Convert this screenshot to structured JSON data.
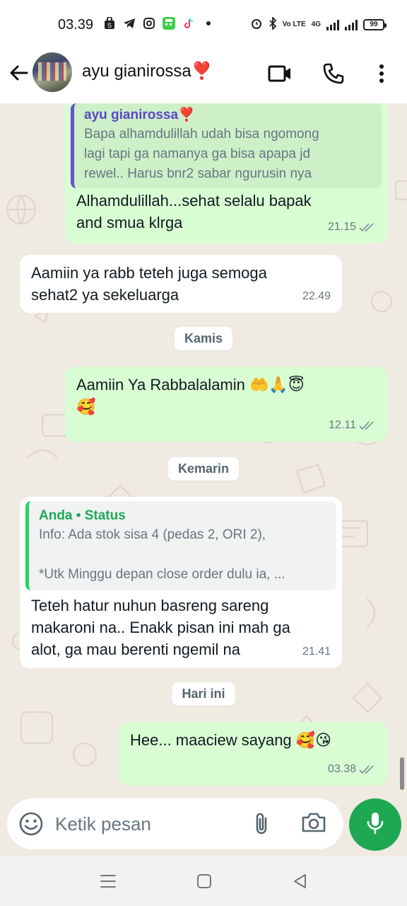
{
  "status_bar": {
    "time": "03.39",
    "battery": "99",
    "network": "4G",
    "volte": "Vo LTE",
    "icons_left": [
      "shopee-icon",
      "telegram-icon",
      "instagram-icon",
      "calculator-icon",
      "tiktok-icon",
      "dot-icon"
    ],
    "icons_right": [
      "alarm-icon",
      "bluetooth-icon",
      "volte-icon",
      "signal-icon",
      "signal-icon",
      "battery-icon"
    ]
  },
  "header": {
    "contact_name": "ayu gianirossa❣️",
    "icons": [
      "back-arrow-icon",
      "video-call-icon",
      "phone-icon",
      "more-vert-icon"
    ]
  },
  "messages": [
    {
      "direction": "out",
      "quote": {
        "name": "ayu gianirossa❣️",
        "lines": [
          "Bapa alhamdulillah udah bisa ngomong",
          "lagi tapi ga namanya ga bisa apapa jd",
          "rewel.. Harus bnr2 sabar ngurusin nya"
        ]
      },
      "lines": [
        "Alhamdulillah...sehat selalu bapak",
        "and smua klrga"
      ],
      "time": "21.15"
    },
    {
      "direction": "in",
      "lines": [
        "Aamiin ya rabb teteh juga semoga",
        "sehat2 ya sekeluarga"
      ],
      "time": "22.49"
    },
    {
      "direction": "out",
      "lines": [
        "Aamiin Ya Rabbalalamin 🤲🙏😇",
        "🥰"
      ],
      "time": "12.11"
    },
    {
      "direction": "in",
      "quote": {
        "name": "Anda • Status",
        "lines": [
          "Info: Ada stok sisa 4 (pedas 2, ORI 2),",
          "",
          "*Utk Minggu depan close order dulu ia, ..."
        ]
      },
      "lines": [
        "Teteh hatur nuhun basreng sareng",
        "makaroni na.. Enakk pisan ini mah ga",
        "alot, ga mau berenti ngemil na"
      ],
      "time": "21.41"
    },
    {
      "direction": "out",
      "lines": [
        "Hee... maaciew sayang 🥰😘"
      ],
      "time": "03.38"
    }
  ],
  "date_separators": [
    "Kamis",
    "Kemarin",
    "Hari ini"
  ],
  "composer": {
    "placeholder": "Ketik pesan",
    "icons": [
      "emoji-icon",
      "attach-icon",
      "camera-icon",
      "mic-icon"
    ]
  },
  "nav_bar": {
    "icons": [
      "menu-icon",
      "home-icon",
      "back-icon"
    ]
  },
  "colors": {
    "outgoing_bubble": "#d9fdd3",
    "incoming_bubble": "#ffffff",
    "chat_background": "#efeae2",
    "accent_green": "#1da851",
    "quote_purple": "#5b45c7",
    "quote_green": "#1fa855"
  }
}
